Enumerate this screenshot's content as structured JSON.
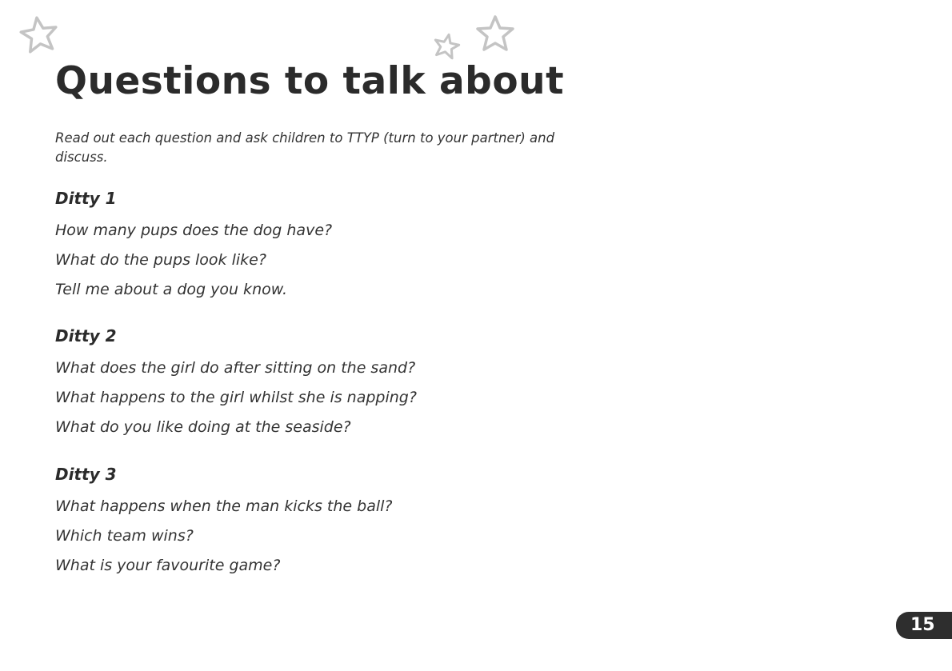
{
  "title": "Questions to talk about",
  "intro": "Read out each question and ask children to TTYP (turn to your partner) and discuss.",
  "sections": [
    {
      "heading": "Ditty 1",
      "questions": [
        "How many pups does the dog have?",
        "What do the pups look like?",
        "Tell me about a dog you know."
      ]
    },
    {
      "heading": "Ditty 2",
      "questions": [
        "What does the girl do after sitting on the sand?",
        "What happens to the girl whilst she is napping?",
        "What do you like doing at the seaside?"
      ]
    },
    {
      "heading": "Ditty 3",
      "questions": [
        "What happens when the man kicks the ball?",
        "Which team wins?",
        "What is your favourite game?"
      ]
    }
  ],
  "page_number": "15",
  "colors": {
    "text": "#2b2b2b",
    "star": "#c4c4c4",
    "badge": "#2e2e2e"
  }
}
